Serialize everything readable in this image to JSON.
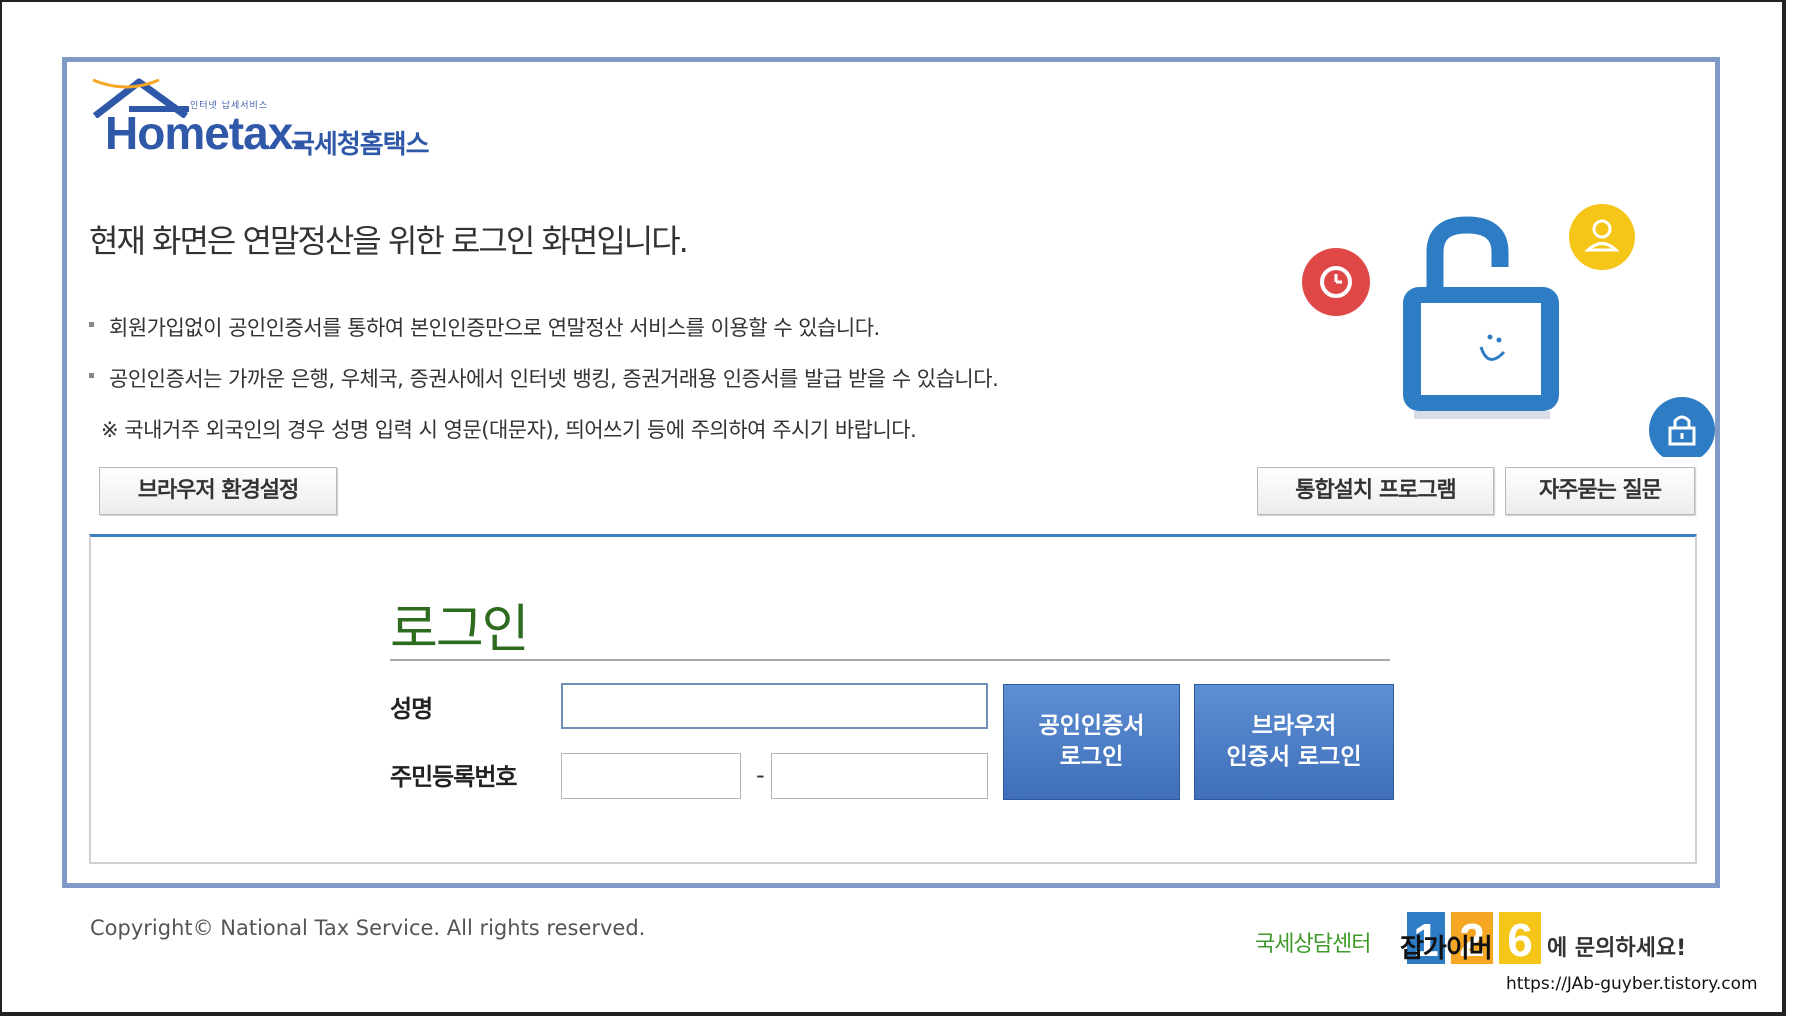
{
  "logo": {
    "tagline": "인터넷 납세서비스",
    "wordmark": "Hometax.",
    "korean_name": "국세청홈택스"
  },
  "heading": "현재 화면은 연말정산을 위한 로그인 화면입니다.",
  "notices": [
    "회원가입없이 공인인증서를 통하여 본인인증만으로 연말정산 서비스를 이용할 수 있습니다.",
    "공인인증서는 가까운 은행, 우체국, 증권사에서 인터넷 뱅킹, 증권거래용 인증서를 발급 받을 수 있습니다."
  ],
  "warning": "※ 국내거주 외국인의 경우 성명 입력 시 영문(대문자), 띄어쓰기 등에 주의하여 주시기 바랍니다.",
  "buttons": {
    "browser_settings": "브라우저 환경설정",
    "integrated_install": "통합설치 프로그램",
    "faq": "자주묻는 질문"
  },
  "login": {
    "title": "로그인",
    "name_label": "성명",
    "name_value": "",
    "rrn_label": "주민등록번호",
    "rrn_front_value": "",
    "rrn_separator": "-",
    "rrn_back_value": "",
    "cert_login_line1": "공인인증서",
    "cert_login_line2": "로그인",
    "browser_cert_line1": "브라우저",
    "browser_cert_line2": "인증서 로그인"
  },
  "footer": {
    "copyright": "Copyright© National Tax Service.  All rights reserved.",
    "helpline_label": "국세상담센터",
    "helpline_number": "126",
    "helpline_suffix": "에 문의하세요!"
  },
  "watermark": {
    "text": "잡가이버",
    "url": "https://JAb-guyber.tistory.com"
  },
  "colors": {
    "panel_border": "#7f9ac6",
    "brand_blue": "#2f58a8",
    "login_green": "#2d6b1f",
    "button_blue": "#4a7cc4",
    "icon_red": "#e04848",
    "icon_yellow": "#f5c518",
    "icon_blue": "#2e7cc4"
  }
}
